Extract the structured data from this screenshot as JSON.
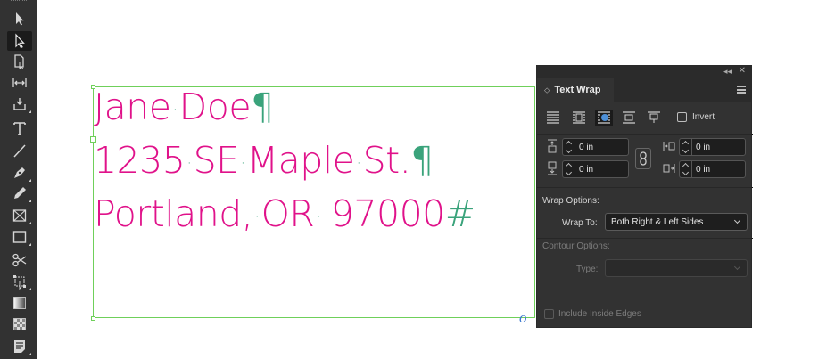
{
  "toolbar": {
    "tools": [
      {
        "name": "selection-tool-icon",
        "glyph": "arrow"
      },
      {
        "name": "direct-selection-tool-icon",
        "glyph": "hollow-arrow",
        "active": true
      },
      {
        "name": "page-tool-icon",
        "glyph": "page"
      },
      {
        "name": "gap-tool-icon",
        "glyph": "gap"
      },
      {
        "name": "content-collector-tool-icon",
        "glyph": "collector"
      },
      {
        "name": "type-tool-icon",
        "glyph": "T"
      },
      {
        "name": "line-tool-icon",
        "glyph": "line"
      },
      {
        "name": "pen-tool-icon",
        "glyph": "pen"
      },
      {
        "name": "pencil-tool-icon",
        "glyph": "pencil"
      },
      {
        "name": "rectangle-frame-tool-icon",
        "glyph": "frame"
      },
      {
        "name": "rectangle-tool-icon",
        "glyph": "rect"
      },
      {
        "name": "scissors-tool-icon",
        "glyph": "scissors"
      },
      {
        "name": "free-transform-tool-icon",
        "glyph": "transform"
      },
      {
        "name": "gradient-swatch-tool-icon",
        "glyph": "gradient"
      },
      {
        "name": "gradient-feather-tool-icon",
        "glyph": "feather"
      },
      {
        "name": "note-tool-icon",
        "glyph": "note"
      }
    ]
  },
  "document": {
    "line1": {
      "words": [
        "Jane",
        "Doe"
      ],
      "end": "¶"
    },
    "line2": {
      "words": [
        "1235",
        "SE",
        "Maple",
        "St."
      ],
      "end": "¶"
    },
    "line3": {
      "words": [
        "Portland,",
        "OR",
        "97000"
      ],
      "end": "#"
    },
    "space_marker": "·",
    "text_color": "#e0128a",
    "hidden_char_color": "#3aa37b",
    "frame_color": "#6fd05a"
  },
  "panel": {
    "title": "Text Wrap",
    "collapse_glyph": "◂◂",
    "close_glyph": "✕",
    "invert_label": "Invert",
    "offsets": {
      "top": "0 in",
      "bottom": "0 in",
      "left": "0 in",
      "right": "0 in"
    },
    "wrap_options_heading": "Wrap Options:",
    "wrap_to_label": "Wrap To:",
    "wrap_to_value": "Both Right & Left Sides",
    "contour_options_heading": "Contour Options:",
    "type_label": "Type:",
    "type_value": "",
    "include_inside_edges_label": "Include Inside Edges"
  }
}
